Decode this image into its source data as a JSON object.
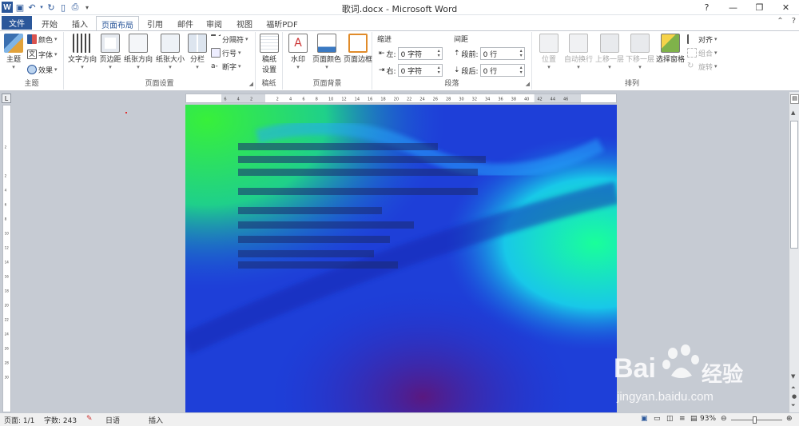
{
  "window": {
    "title": "歌词.docx - Microsoft Word"
  },
  "tabs": [
    {
      "label": "文件"
    },
    {
      "label": "开始"
    },
    {
      "label": "插入"
    },
    {
      "label": "页面布局"
    },
    {
      "label": "引用"
    },
    {
      "label": "邮件"
    },
    {
      "label": "审阅"
    },
    {
      "label": "视图"
    },
    {
      "label": "福昕PDF"
    }
  ],
  "ribbon": {
    "theme": {
      "big": "主题",
      "colors": "颜色",
      "fonts": "字体",
      "effects": "效果",
      "label": "主题"
    },
    "page_setup": {
      "text_direction": "文字方向",
      "margins": "页边距",
      "orientation": "纸张方向",
      "size": "纸张大小",
      "columns": "分栏",
      "breaks": "分隔符",
      "line_numbers": "行号",
      "hyphenation": "断字",
      "label": "页面设置"
    },
    "draft": {
      "big": "稿纸",
      "big2": "设置",
      "label": "稿纸"
    },
    "background": {
      "watermark": "水印",
      "page_color": "页面颜色",
      "page_borders": "页面边框",
      "label": "页面背景"
    },
    "paragraph": {
      "indent": "缩进",
      "left": "左:",
      "right": "右:",
      "left_value": "0 字符",
      "right_value": "0 字符",
      "spacing": "间距",
      "before": "段前:",
      "after": "段后:",
      "before_value": "0 行",
      "after_value": "0 行",
      "label": "段落"
    },
    "arrange": {
      "position": "位置",
      "wrap": "自动换行",
      "forward": "上移一层",
      "backward": "下移一层",
      "selection_pane": "选择窗格",
      "align": "对齐",
      "group": "组合",
      "rotate": "旋转",
      "label": "排列"
    }
  },
  "ruler": {
    "ticks": [
      "6",
      "4",
      "2",
      "",
      "2",
      "4",
      "6",
      "8",
      "10",
      "12",
      "14",
      "16",
      "18",
      "20",
      "22",
      "24",
      "26",
      "28",
      "30",
      "32",
      "34",
      "36",
      "38",
      "40",
      "42",
      "44",
      "46"
    ]
  },
  "vruler": {
    "ticks": [
      "2",
      "",
      "2",
      "4",
      "6",
      "8",
      "10",
      "12",
      "14",
      "16",
      "18",
      "20",
      "22",
      "24",
      "26",
      "28",
      "30"
    ]
  },
  "status": {
    "page": "页面: 1/1",
    "words": "字数: 243",
    "lang": "日语",
    "mode": "插入",
    "zoom": "93%"
  },
  "watermark": {
    "brand": "Bai",
    "brand2": "经验",
    "url": "jingyan.baidu.com"
  },
  "colors": {
    "accent": "#2b579a"
  }
}
